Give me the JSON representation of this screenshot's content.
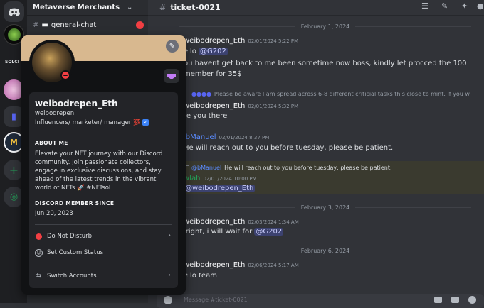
{
  "server": {
    "name": "Metaverse Merchants",
    "label": "SOLCI"
  },
  "channels": {
    "current": "general-chat",
    "unread": "1"
  },
  "header": {
    "channel": "ticket-0021"
  },
  "dates": [
    "February 1, 2024",
    "February 3, 2024",
    "February 6, 2024"
  ],
  "messages": {
    "m1_author": "weibodrepen_Eth",
    "m1_time": "02/01/2024 5:22 PM",
    "m1_l1_pre": "ello ",
    "m1_l1_mention": "@G202",
    "m1_l2": "ou havent get back to me been sometime now boss, kindly let procced the 100",
    "m1_l3": "member for 35$",
    "r1_text": "Please be aware I am spread across 6-8 different criticial tasks this close to mint. If you w",
    "m2_author": "weibodrepen_Eth",
    "m2_time": "02/01/2024 5:32 PM",
    "m2_l1": "re you there",
    "m3_author": "ibManuel",
    "m3_time": "02/01/2024 8:37 PM",
    "m3_l1": "He will reach out to you before tuesday, please be patient.",
    "r2_author": "@bManuel",
    "r2_text": "He will reach out to you before tuesday, please be patient.",
    "m4_author": "wlah",
    "m4_time": "02/01/2024 10:00 PM",
    "m4_mention": "@weibodrepen_Eth",
    "m5_author": "weibodrepen_Eth",
    "m5_time": "02/03/2024 1:34 AM",
    "m5_pre": "lright, i will wait for ",
    "m5_mention": "@G202",
    "m6_author": "weibodrepen_Eth",
    "m6_time": "02/06/2024 5:17 AM",
    "m6_l1": "ello team"
  },
  "composer": {
    "placeholder": "Message #ticket-0021"
  },
  "profile": {
    "display_name": "weibodrepen_Eth",
    "username": "weibodrepen",
    "tagline": "Influencers/ marketer/ manager 💯",
    "about_title": "ABOUT ME",
    "about": "Elevate your NFT journey with our Discord community. Join passionate collectors, engage in exclusive discussions, and stay ahead of the latest trends in the vibrant world of NFTs 🚀 #NFTsol",
    "since_title": "DISCORD MEMBER SINCE",
    "since": "Jun 20, 2023",
    "menu_dnd": "Do Not Disturb",
    "menu_status": "Set Custom Status",
    "menu_switch": "Switch Accounts"
  },
  "colors": {
    "accent": "#5865f2",
    "dnd": "#f23f43",
    "mention_bg": "#3c4270",
    "banner": "#d8b88f"
  }
}
